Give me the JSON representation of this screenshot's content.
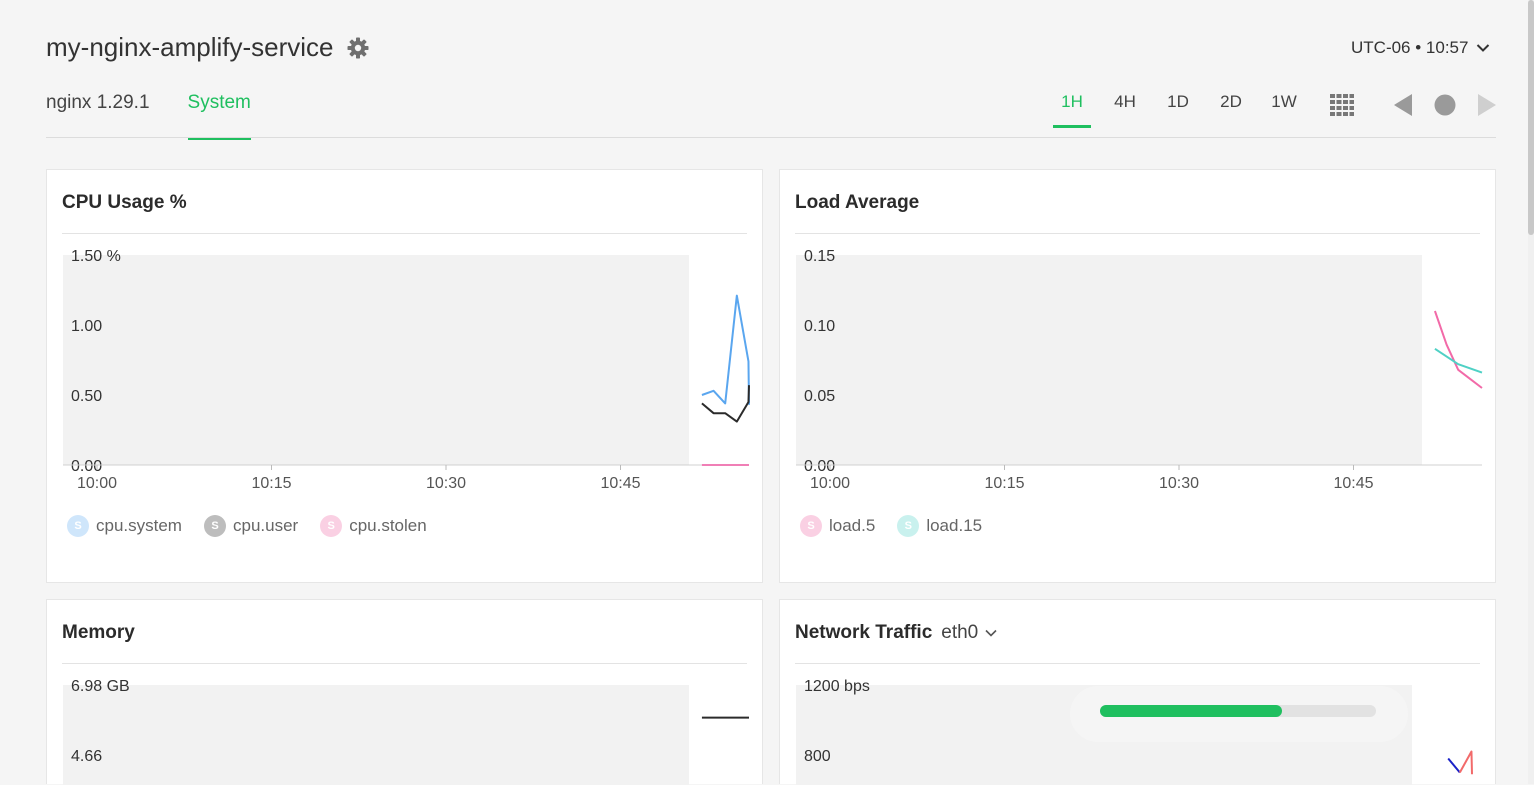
{
  "header": {
    "service_name": "my-nginx-amplify-service",
    "timezone_label": "UTC-06 • 10:57"
  },
  "tabs": [
    {
      "label": "nginx 1.29.1",
      "active": false
    },
    {
      "label": "System",
      "active": true
    }
  ],
  "time_ranges": [
    {
      "label": "1H",
      "active": true
    },
    {
      "label": "4H",
      "active": false
    },
    {
      "label": "1D",
      "active": false
    },
    {
      "label": "2D",
      "active": false
    },
    {
      "label": "1W",
      "active": false
    }
  ],
  "icons": {
    "settings": "gear-icon",
    "timezone_dropdown": "chevron-down-icon",
    "layout": "grid-icon",
    "prev": "triangle-left-icon",
    "live": "circle-icon",
    "next": "triangle-right-icon"
  },
  "colors": {
    "accent": "#1fbf5f",
    "cpu_system": "#5aa6ef",
    "cpu_user": "#2b2b2b",
    "cpu_stolen": "#f07fb6",
    "load5": "#f26aa8",
    "load15": "#4fd1c5"
  },
  "progress": {
    "value": 0.66
  },
  "chart_data": [
    {
      "type": "line",
      "title": "CPU Usage %",
      "y_ticks": [
        "1.50 %",
        "1.00",
        "0.50",
        "0.00"
      ],
      "ylim": [
        0,
        1.5
      ],
      "x_ticks": [
        "10:00",
        "10:15",
        "10:30",
        "10:45"
      ],
      "series": [
        {
          "name": "cpu.system",
          "legend_icon": "S",
          "color": "#5aa6ef",
          "legend_color": "#cfe6fb",
          "x": [
            "10:52",
            "10:53",
            "10:54",
            "10:55",
            "10:56",
            "10:57"
          ],
          "values": [
            0.5,
            0.53,
            0.44,
            1.21,
            0.74,
            0.43
          ]
        },
        {
          "name": "cpu.user",
          "legend_icon": "S",
          "color": "#2b2b2b",
          "legend_color": "#bdbdbd",
          "x": [
            "10:52",
            "10:53",
            "10:54",
            "10:55",
            "10:56",
            "10:57"
          ],
          "values": [
            0.44,
            0.37,
            0.37,
            0.31,
            0.45,
            0.57
          ]
        },
        {
          "name": "cpu.stolen",
          "legend_icon": "S",
          "color": "#f07fb6",
          "legend_color": "#fad0e3",
          "x": [
            "10:52",
            "10:57"
          ],
          "values": [
            0.0,
            0.0
          ]
        }
      ]
    },
    {
      "type": "line",
      "title": "Load Average",
      "y_ticks": [
        "0.15",
        "0.10",
        "0.05",
        "0.00"
      ],
      "ylim": [
        0,
        0.15
      ],
      "x_ticks": [
        "10:00",
        "10:15",
        "10:30",
        "10:45"
      ],
      "series": [
        {
          "name": "load.5",
          "legend_icon": "S",
          "color": "#f26aa8",
          "legend_color": "#fad0e3",
          "x": [
            "10:52",
            "10:53",
            "10:54",
            "10:57"
          ],
          "values": [
            0.11,
            0.086,
            0.068,
            0.055
          ]
        },
        {
          "name": "load.15",
          "legend_icon": "S",
          "color": "#4fd1c5",
          "legend_color": "#c9f1ee",
          "x": [
            "10:52",
            "10:54",
            "10:57"
          ],
          "values": [
            0.083,
            0.072,
            0.066
          ]
        }
      ]
    },
    {
      "type": "line",
      "title": "Memory",
      "y_ticks": [
        "6.98 GB",
        "4.66"
      ],
      "series": [
        {
          "name": "",
          "color": "#2b2b2b",
          "x": [
            "10:52",
            "10:57"
          ],
          "values": [
            5.9,
            5.9
          ]
        }
      ]
    },
    {
      "type": "line",
      "title": "Network Traffic",
      "interface_selector": "eth0",
      "y_ticks": [
        "1200 bps",
        "800"
      ],
      "series": [
        {
          "name": "",
          "color": "#1a22c8",
          "x": [
            "10:54",
            "10:55"
          ],
          "values": [
            780,
            700
          ]
        },
        {
          "name": "",
          "color": "#f26a6a",
          "x": [
            "10:55",
            "10:56",
            "10:57"
          ],
          "values": [
            700,
            820,
            690
          ]
        }
      ]
    }
  ]
}
